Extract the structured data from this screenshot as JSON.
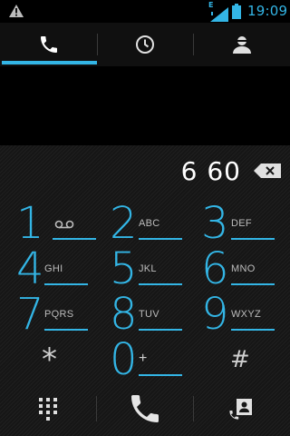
{
  "status_bar": {
    "time": "19:09",
    "network_label": "E",
    "icons": [
      "warning-icon",
      "signal-icon",
      "battery-icon"
    ]
  },
  "tabs": [
    {
      "name": "phone",
      "icon": "phone-icon",
      "active": true
    },
    {
      "name": "recent",
      "icon": "clock-icon",
      "active": false
    },
    {
      "name": "contacts",
      "icon": "person-icon",
      "active": false
    }
  ],
  "dial_display": {
    "digits": "6 60"
  },
  "keypad": {
    "keys": [
      {
        "digit": "1",
        "letters": ""
      },
      {
        "digit": "2",
        "letters": "ABC"
      },
      {
        "digit": "3",
        "letters": "DEF"
      },
      {
        "digit": "4",
        "letters": "GHI"
      },
      {
        "digit": "5",
        "letters": "JKL"
      },
      {
        "digit": "6",
        "letters": "MNO"
      },
      {
        "digit": "7",
        "letters": "PQRS"
      },
      {
        "digit": "8",
        "letters": "TUV"
      },
      {
        "digit": "9",
        "letters": "WXYZ"
      },
      {
        "digit": "*",
        "letters": ""
      },
      {
        "digit": "0",
        "letters": "+"
      },
      {
        "digit": "#",
        "letters": ""
      }
    ]
  },
  "bottom_bar": {
    "buttons": [
      "dialpad-icon",
      "call-icon",
      "add-contact-icon"
    ]
  },
  "colors": {
    "accent": "#33b5e5",
    "background": "#000000",
    "keypad_background": "#161616",
    "text": "#ffffff",
    "letters": "#bcbcbc"
  }
}
